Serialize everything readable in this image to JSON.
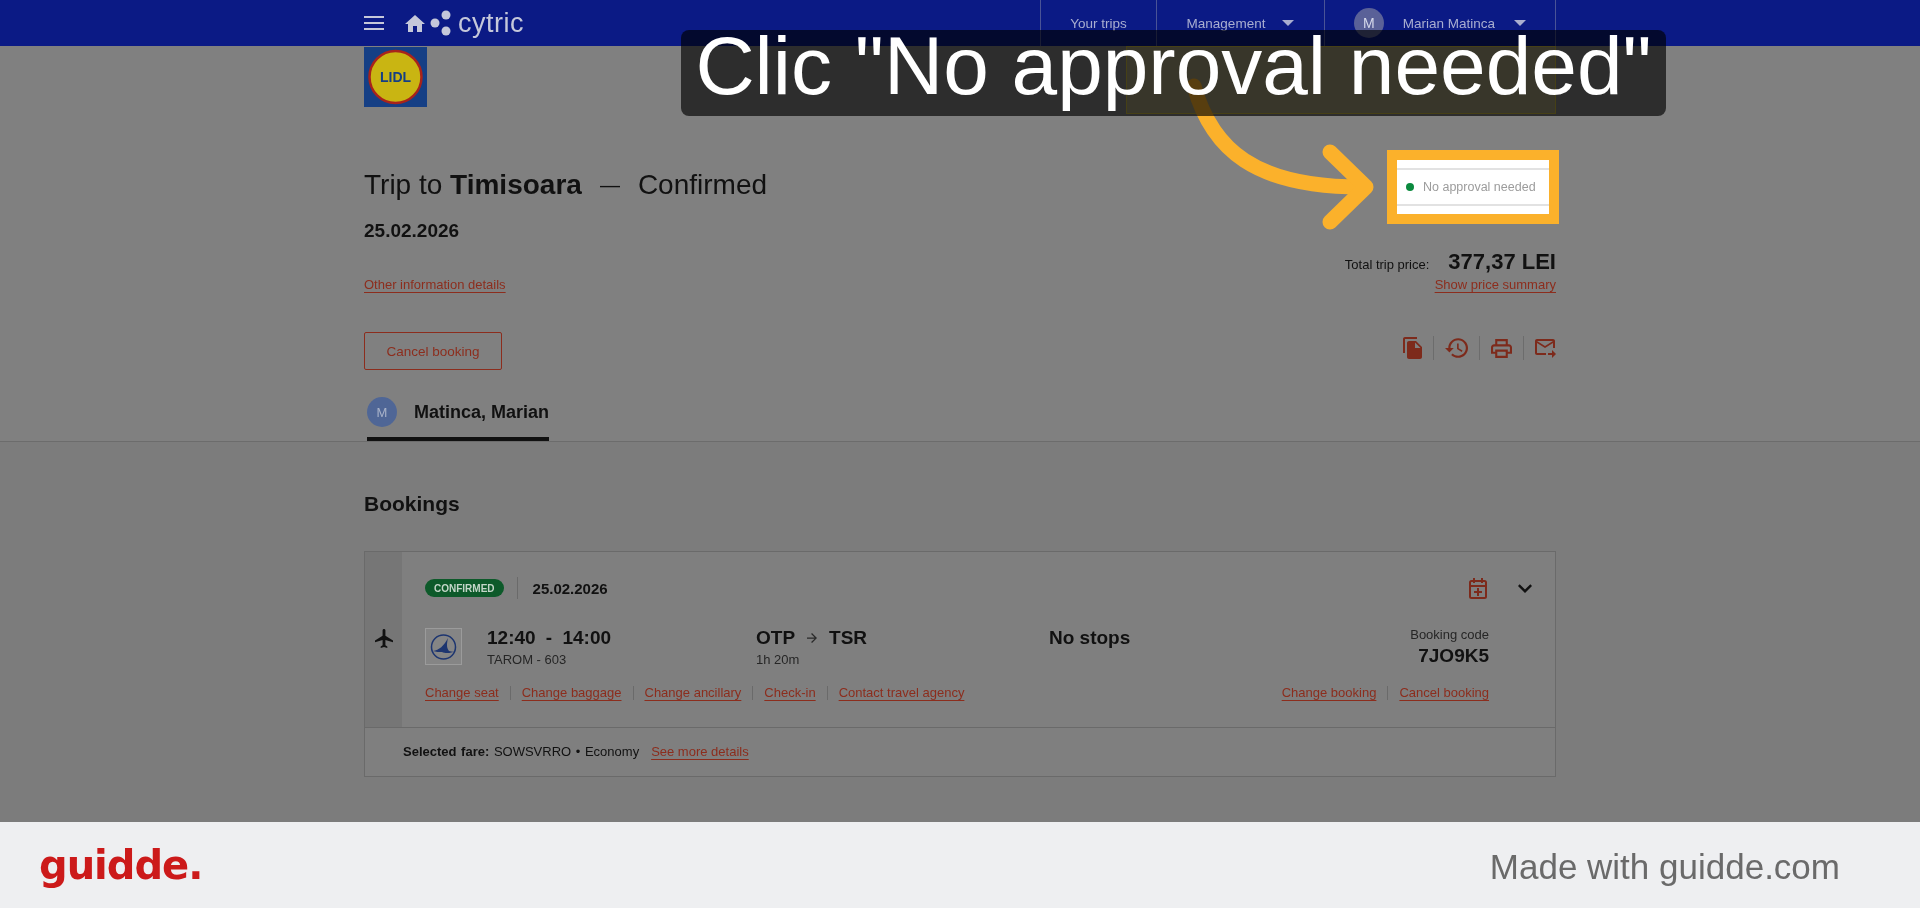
{
  "top_nav": {
    "brand": "cytric",
    "items": [
      {
        "label": "Your trips",
        "dropdown": false
      },
      {
        "label": "Management",
        "dropdown": true
      }
    ],
    "user": {
      "initial": "M",
      "name": "Marian Matinca",
      "dropdown": true
    }
  },
  "company_logo": {
    "text": "LIDL"
  },
  "trip": {
    "title": "Trip to **Timisoara**",
    "separator": "—",
    "status": "Confirmed",
    "date": "25.02.2026",
    "details_link": "Other information details",
    "cancel_button": "Cancel booking"
  },
  "approval": {
    "text": "No approval needed",
    "highlighted": true
  },
  "price": {
    "label": "Total trip price:",
    "amount": "377,37 LEI",
    "summary_link": "Show price summary"
  },
  "travelers": [
    {
      "initial": "M",
      "name": "Matinca, Marian",
      "selected": true
    }
  ],
  "bookings": {
    "heading": "Bookings",
    "items": [
      {
        "kind": "flight",
        "status": "CONFIRMED",
        "date": "25.02.2026",
        "expanded": false,
        "times": "12:40 - 14:00",
        "carrier": "TAROM - 603",
        "origin": "OTP",
        "destination": "TSR",
        "duration": "1h 20m",
        "stops": "No stops",
        "code_label": "Booking code",
        "code": "7JO9K5",
        "actions": [
          "Change seat",
          "Change baggage",
          "Change ancillary",
          "Check-in",
          "Contact travel agency"
        ],
        "manage_actions": [
          "Change booking",
          "Cancel booking"
        ],
        "fare": "**Selected fare:** SOWSVRRO • Economy",
        "fare_link": "See more details"
      }
    ]
  },
  "instruction": {
    "text": "Clic \"No approval needed\""
  },
  "footer": {
    "brand": "guidde.",
    "tagline": "Made with guidde.com"
  }
}
